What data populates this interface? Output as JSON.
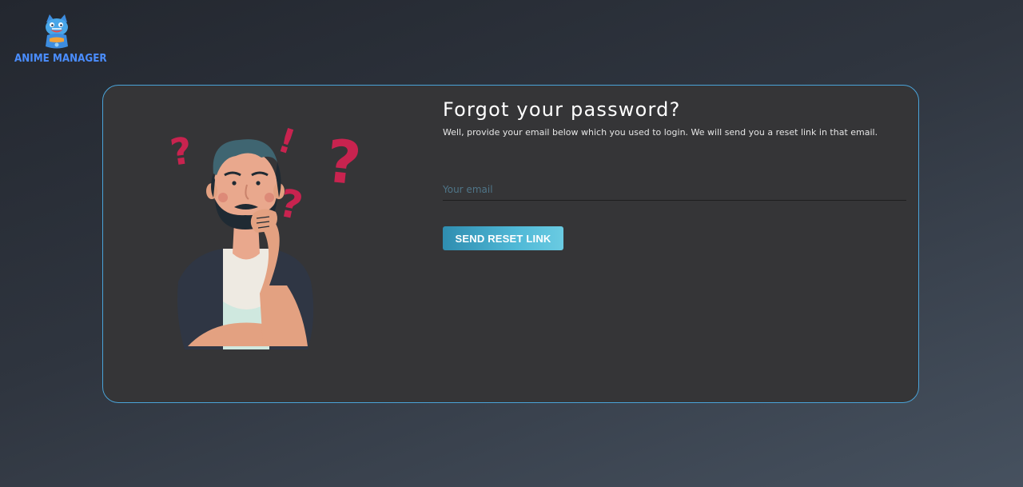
{
  "brand": {
    "name": "ANIME MANAGER",
    "mascot_icon": "cat-mascot-logo-icon",
    "color": "#4a8dff"
  },
  "card": {
    "illustration_icon": "confused-man-illustration",
    "border_color": "#4aa3d8",
    "background": "#353537"
  },
  "form": {
    "title": "Forgot your password?",
    "subtitle": "Well, provide your email below which you used to login. We will send you a reset link in that email.",
    "email": {
      "placeholder": "Your email",
      "value": ""
    },
    "submit_label": "SEND RESET LINK",
    "accent": "#4fb8d6"
  }
}
